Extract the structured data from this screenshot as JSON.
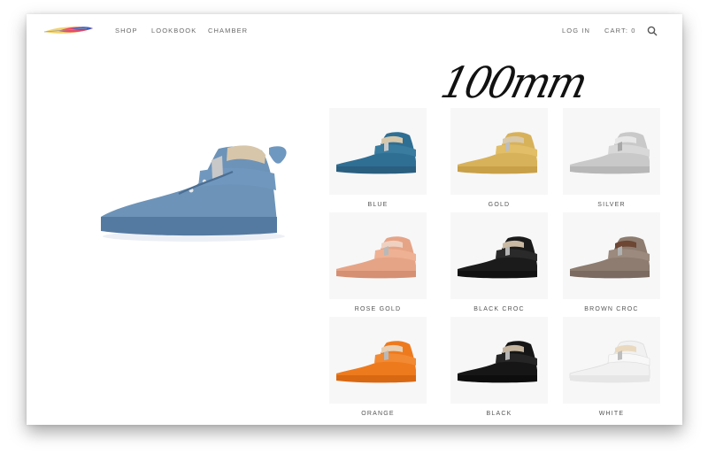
{
  "nav": {
    "items": [
      "SHOP",
      "LOOKBOOK",
      "CHAMBER"
    ],
    "login": "LOG IN",
    "cart": "CART: 0"
  },
  "heading": "100mm",
  "featured": {
    "name": "featured-blue-sneaker",
    "color": "#6d93b8"
  },
  "products": [
    {
      "label": "BLUE",
      "color": "#2f6f94"
    },
    {
      "label": "GOLD",
      "color": "#d8b25a"
    },
    {
      "label": "SILVER",
      "color": "#c9c9c9"
    },
    {
      "label": "ROSE GOLD",
      "color": "#e6a486"
    },
    {
      "label": "BLACK CROC",
      "color": "#1b1b1b"
    },
    {
      "label": "BROWN CROC",
      "color": "#8d7c6f"
    },
    {
      "label": "ORANGE",
      "color": "#ee7a1e"
    },
    {
      "label": "BLACK",
      "color": "#161616"
    },
    {
      "label": "WHITE",
      "color": "#f1f1f1"
    }
  ]
}
